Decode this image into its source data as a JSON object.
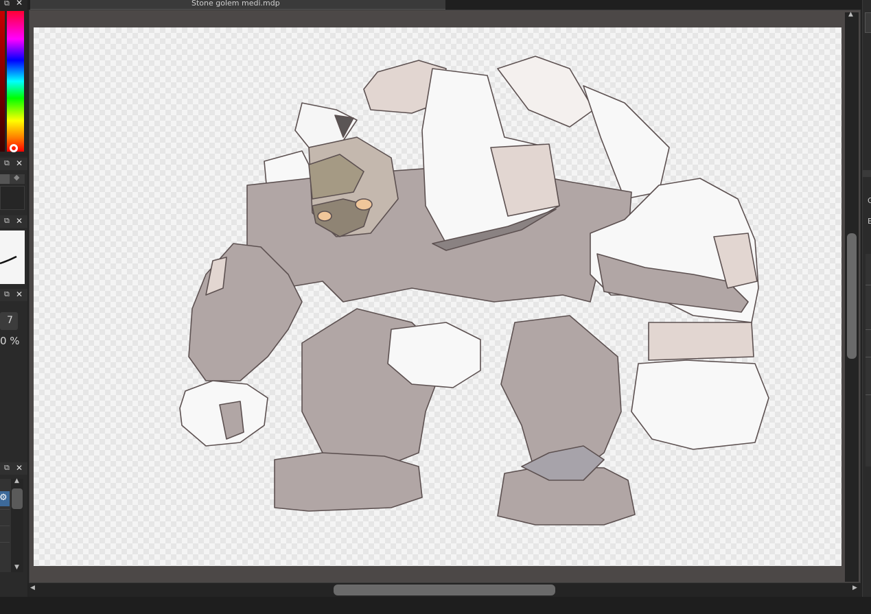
{
  "document": {
    "tab_title": "Stone golem medi.mdp"
  },
  "left_panels": {
    "brush_size_value": "7",
    "opacity_value": "0 %"
  },
  "icons": {
    "dock": "undock-icon",
    "close": "close-icon",
    "gear": "gear-icon",
    "arrow_up": "arrow-up-icon",
    "arrow_down": "arrow-down-icon",
    "arrow_left": "arrow-left-icon",
    "arrow_right": "arrow-right-icon"
  },
  "right_panel": {
    "labels": [
      "G",
      "E"
    ]
  },
  "colors": {
    "app_bg": "#232323",
    "canvas_area": "#4c4847",
    "panel_dark": "#2b2b2b",
    "golem_body": "#b1a6a5",
    "golem_highlight": "#e2d6d1"
  }
}
